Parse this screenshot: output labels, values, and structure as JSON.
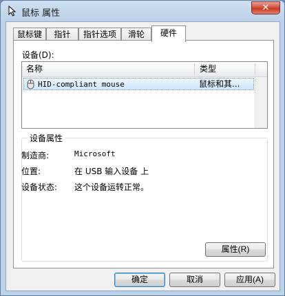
{
  "window": {
    "title": "鼠标 属性",
    "close_glyph": "✕"
  },
  "tabs": [
    {
      "label": "鼠标键",
      "active": false
    },
    {
      "label": "指针",
      "active": false
    },
    {
      "label": "指针选项",
      "active": false
    },
    {
      "label": "滑轮",
      "active": false
    },
    {
      "label": "硬件",
      "active": true
    }
  ],
  "hardware": {
    "devices_label": "设备(D):",
    "columns": [
      "名称",
      "类型"
    ],
    "rows": [
      {
        "name": "HID-compliant mouse",
        "type": "鼠标和其...",
        "selected": true
      }
    ],
    "properties_title": "设备属性",
    "properties": [
      {
        "label": "制造商:",
        "value": "Microsoft"
      },
      {
        "label": "位置:",
        "value": "在 USB 输入设备 上"
      },
      {
        "label": "设备状态:",
        "value": "这个设备运转正常。"
      }
    ],
    "properties_button": "属性(R)"
  },
  "footer": {
    "ok_label": "确定",
    "cancel_label": "取消",
    "apply_label": "应用(A)"
  },
  "colors": {
    "title_bg": "#bcd2ea",
    "close_red": "#c7381f",
    "selected_row": "#cde6fb",
    "default_button_border": "#3c7fb1"
  }
}
